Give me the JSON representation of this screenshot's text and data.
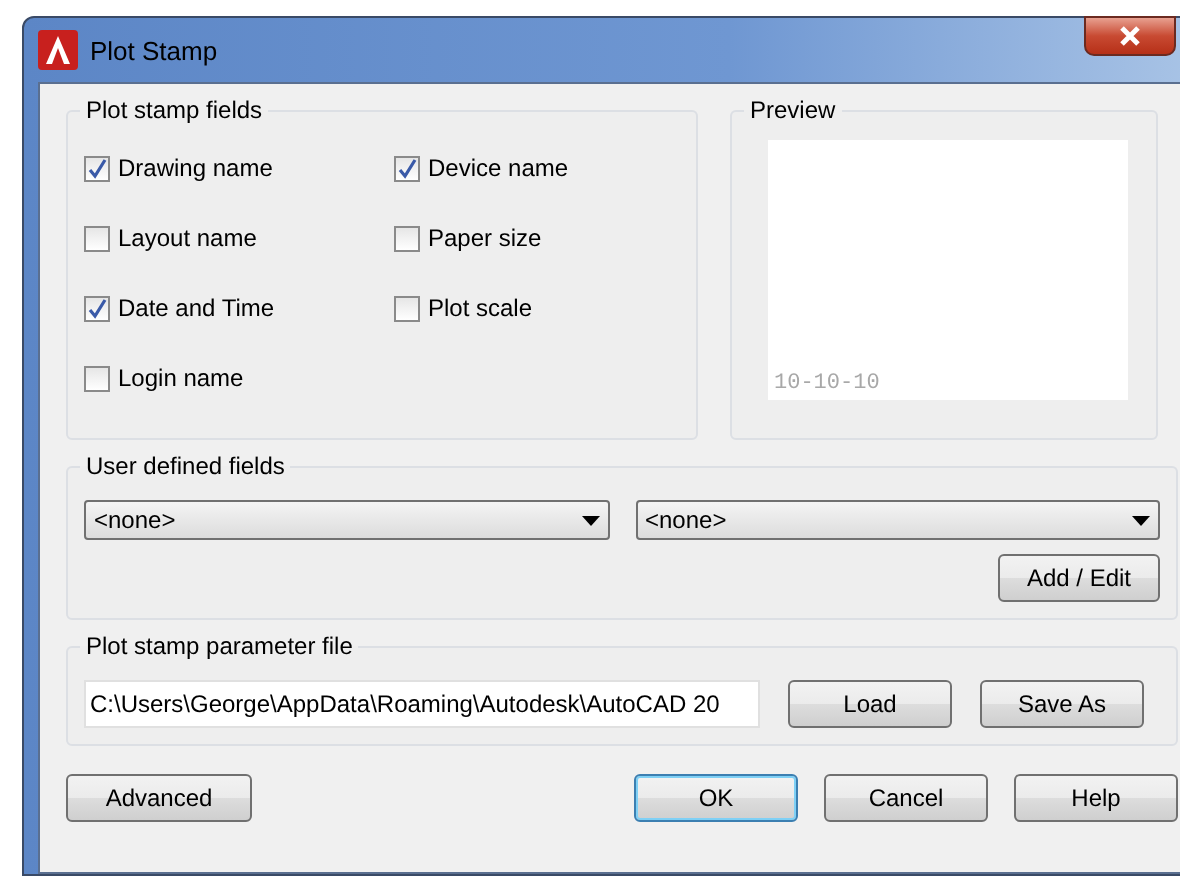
{
  "window": {
    "title": "Plot Stamp"
  },
  "plot_stamp_fields": {
    "title": "Plot stamp fields",
    "items": [
      {
        "label": "Drawing name",
        "checked": true
      },
      {
        "label": "Device name",
        "checked": true
      },
      {
        "label": "Layout name",
        "checked": false
      },
      {
        "label": "Paper size",
        "checked": false
      },
      {
        "label": "Date and Time",
        "checked": true
      },
      {
        "label": "Plot scale",
        "checked": false
      },
      {
        "label": "Login name",
        "checked": false
      }
    ]
  },
  "preview": {
    "title": "Preview",
    "sample": "10-10-10"
  },
  "user_defined_fields": {
    "title": "User defined fields",
    "dropdowns": [
      "<none>",
      "<none>"
    ],
    "button": "Add / Edit"
  },
  "parameter_file": {
    "title": "Plot stamp parameter file",
    "value": "C:\\Users\\George\\AppData\\Roaming\\Autodesk\\AutoCAD 20",
    "buttons": [
      "Load",
      "Save As"
    ]
  },
  "footer_buttons": [
    {
      "label": "Advanced",
      "selected": false
    },
    {
      "label": "OK",
      "selected": true
    },
    {
      "label": "Cancel",
      "selected": false
    },
    {
      "label": "Help",
      "selected": false
    }
  ]
}
